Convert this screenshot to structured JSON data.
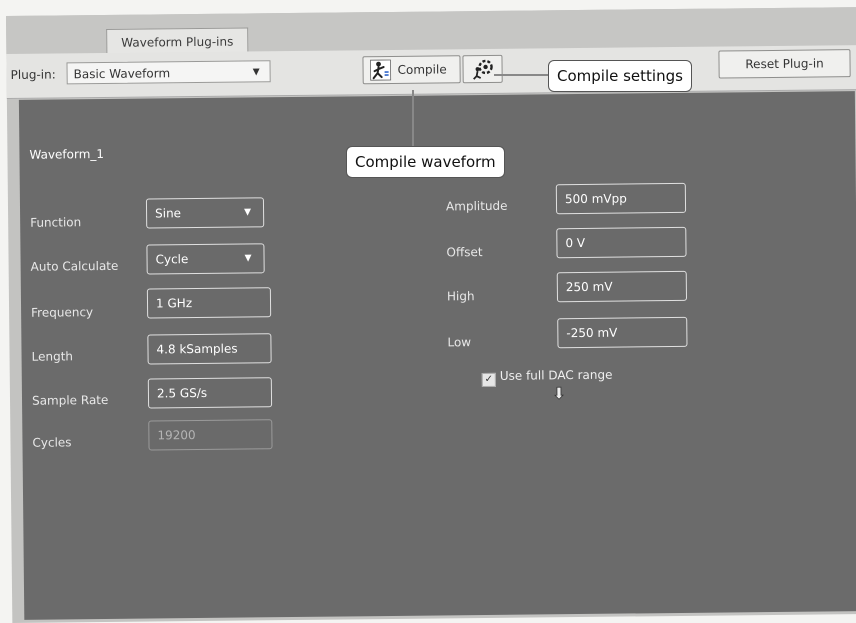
{
  "tab": {
    "label": "Waveform Plug-ins"
  },
  "toolbar": {
    "plugin_label": "Plug-in:",
    "plugin_value": "Basic Waveform",
    "compile_label": "Compile",
    "reset_label": "Reset Plug-in"
  },
  "callouts": {
    "compile_settings": "Compile settings",
    "compile_waveform": "Compile waveform"
  },
  "panel": {
    "title": "Waveform_1",
    "left_fields": [
      {
        "label": "Function",
        "value": "Sine"
      },
      {
        "label": "Auto Calculate",
        "value": "Cycle"
      },
      {
        "label": "Frequency",
        "value": "1 GHz"
      },
      {
        "label": "Length",
        "value": "4.8 kSamples"
      },
      {
        "label": "Sample Rate",
        "value": "2.5 GS/s"
      },
      {
        "label": "Cycles",
        "value": "19200"
      }
    ],
    "right_fields": [
      {
        "label": "Amplitude",
        "value": "500 mVpp"
      },
      {
        "label": "Offset",
        "value": "0 V"
      },
      {
        "label": "High",
        "value": "250 mV"
      },
      {
        "label": "Low",
        "value": "-250 mV"
      }
    ],
    "dac_checkbox": {
      "label": "Use full DAC range",
      "checked": true
    }
  }
}
